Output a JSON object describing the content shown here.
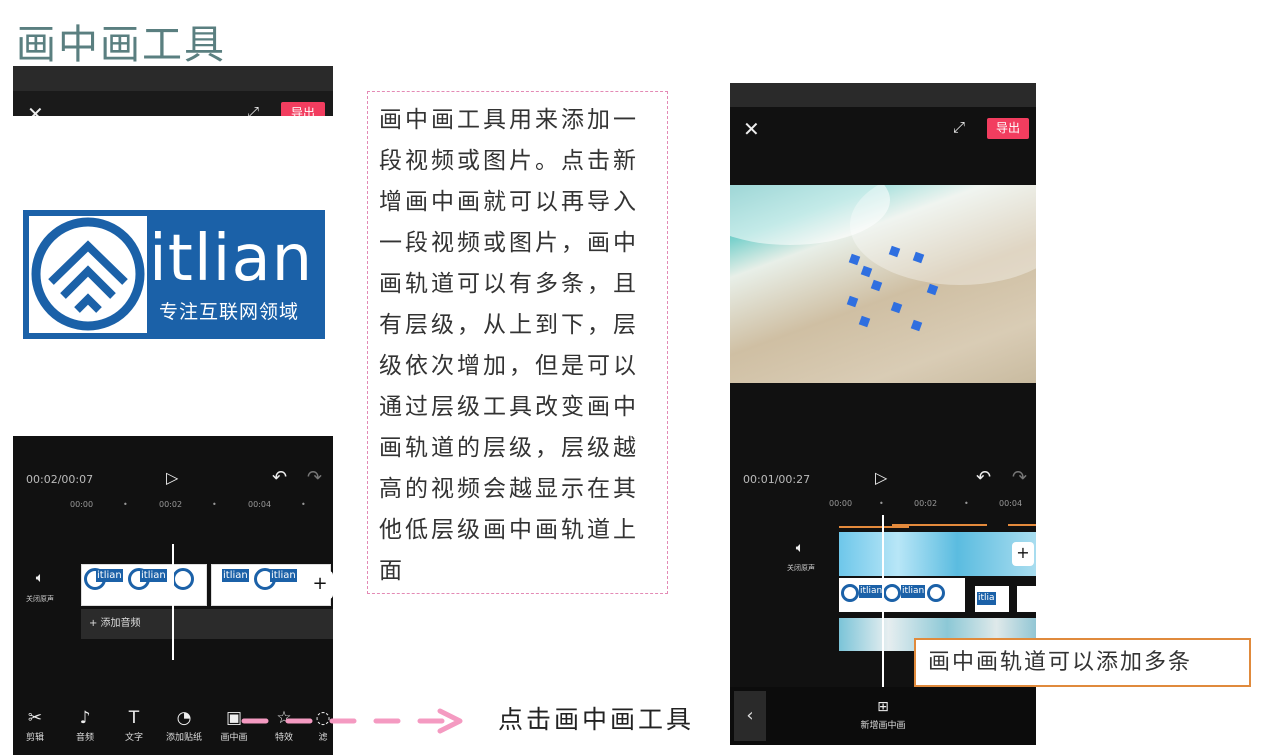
{
  "title": "画中画工具",
  "description": "画中画工具用来添加一段视频或图片。点击新增画中画就可以再导入一段视频或图片，画中画轨道可以有多条，且有层级，从上到下，层级依次增加，但是可以通过层级工具改变画中画轨道的层级，层级越高的视频会越显示在其他低层级画中画轨道上面",
  "caption": "点击画中画工具",
  "callout": "画中画轨道可以添加多条",
  "phone1": {
    "export_label": "导出",
    "logo_text": "itlian",
    "logo_subtitle": "专注互联网领域",
    "time": "00:02/00:07",
    "ruler": [
      "00:00",
      "00:02",
      "00:04"
    ],
    "mute_label": "关闭原声",
    "clip_text": "itlian",
    "add_audio": "+ 添加音频",
    "tools": [
      {
        "icon": "scissors-icon",
        "label": "剪辑"
      },
      {
        "icon": "music-note-icon",
        "label": "音频"
      },
      {
        "icon": "text-icon",
        "label": "文字"
      },
      {
        "icon": "sticker-icon",
        "label": "添加贴纸"
      },
      {
        "icon": "pip-icon",
        "label": "画中画"
      },
      {
        "icon": "effects-icon",
        "label": "特效"
      },
      {
        "icon": "filter-icon",
        "label": "滤"
      }
    ]
  },
  "phone2": {
    "export_label": "导出",
    "time": "00:01/00:27",
    "ruler": [
      "00:00",
      "00:02",
      "00:04"
    ],
    "mute_label": "关闭原声",
    "clip_text": "itlia",
    "new_pip_label": "新增画中画"
  },
  "colors": {
    "title": "#5a7f80",
    "export": "#f23d5f",
    "dashed_border": "#e48ab5",
    "callout_border": "#e08a3c",
    "arrow": "#f49ac1"
  }
}
